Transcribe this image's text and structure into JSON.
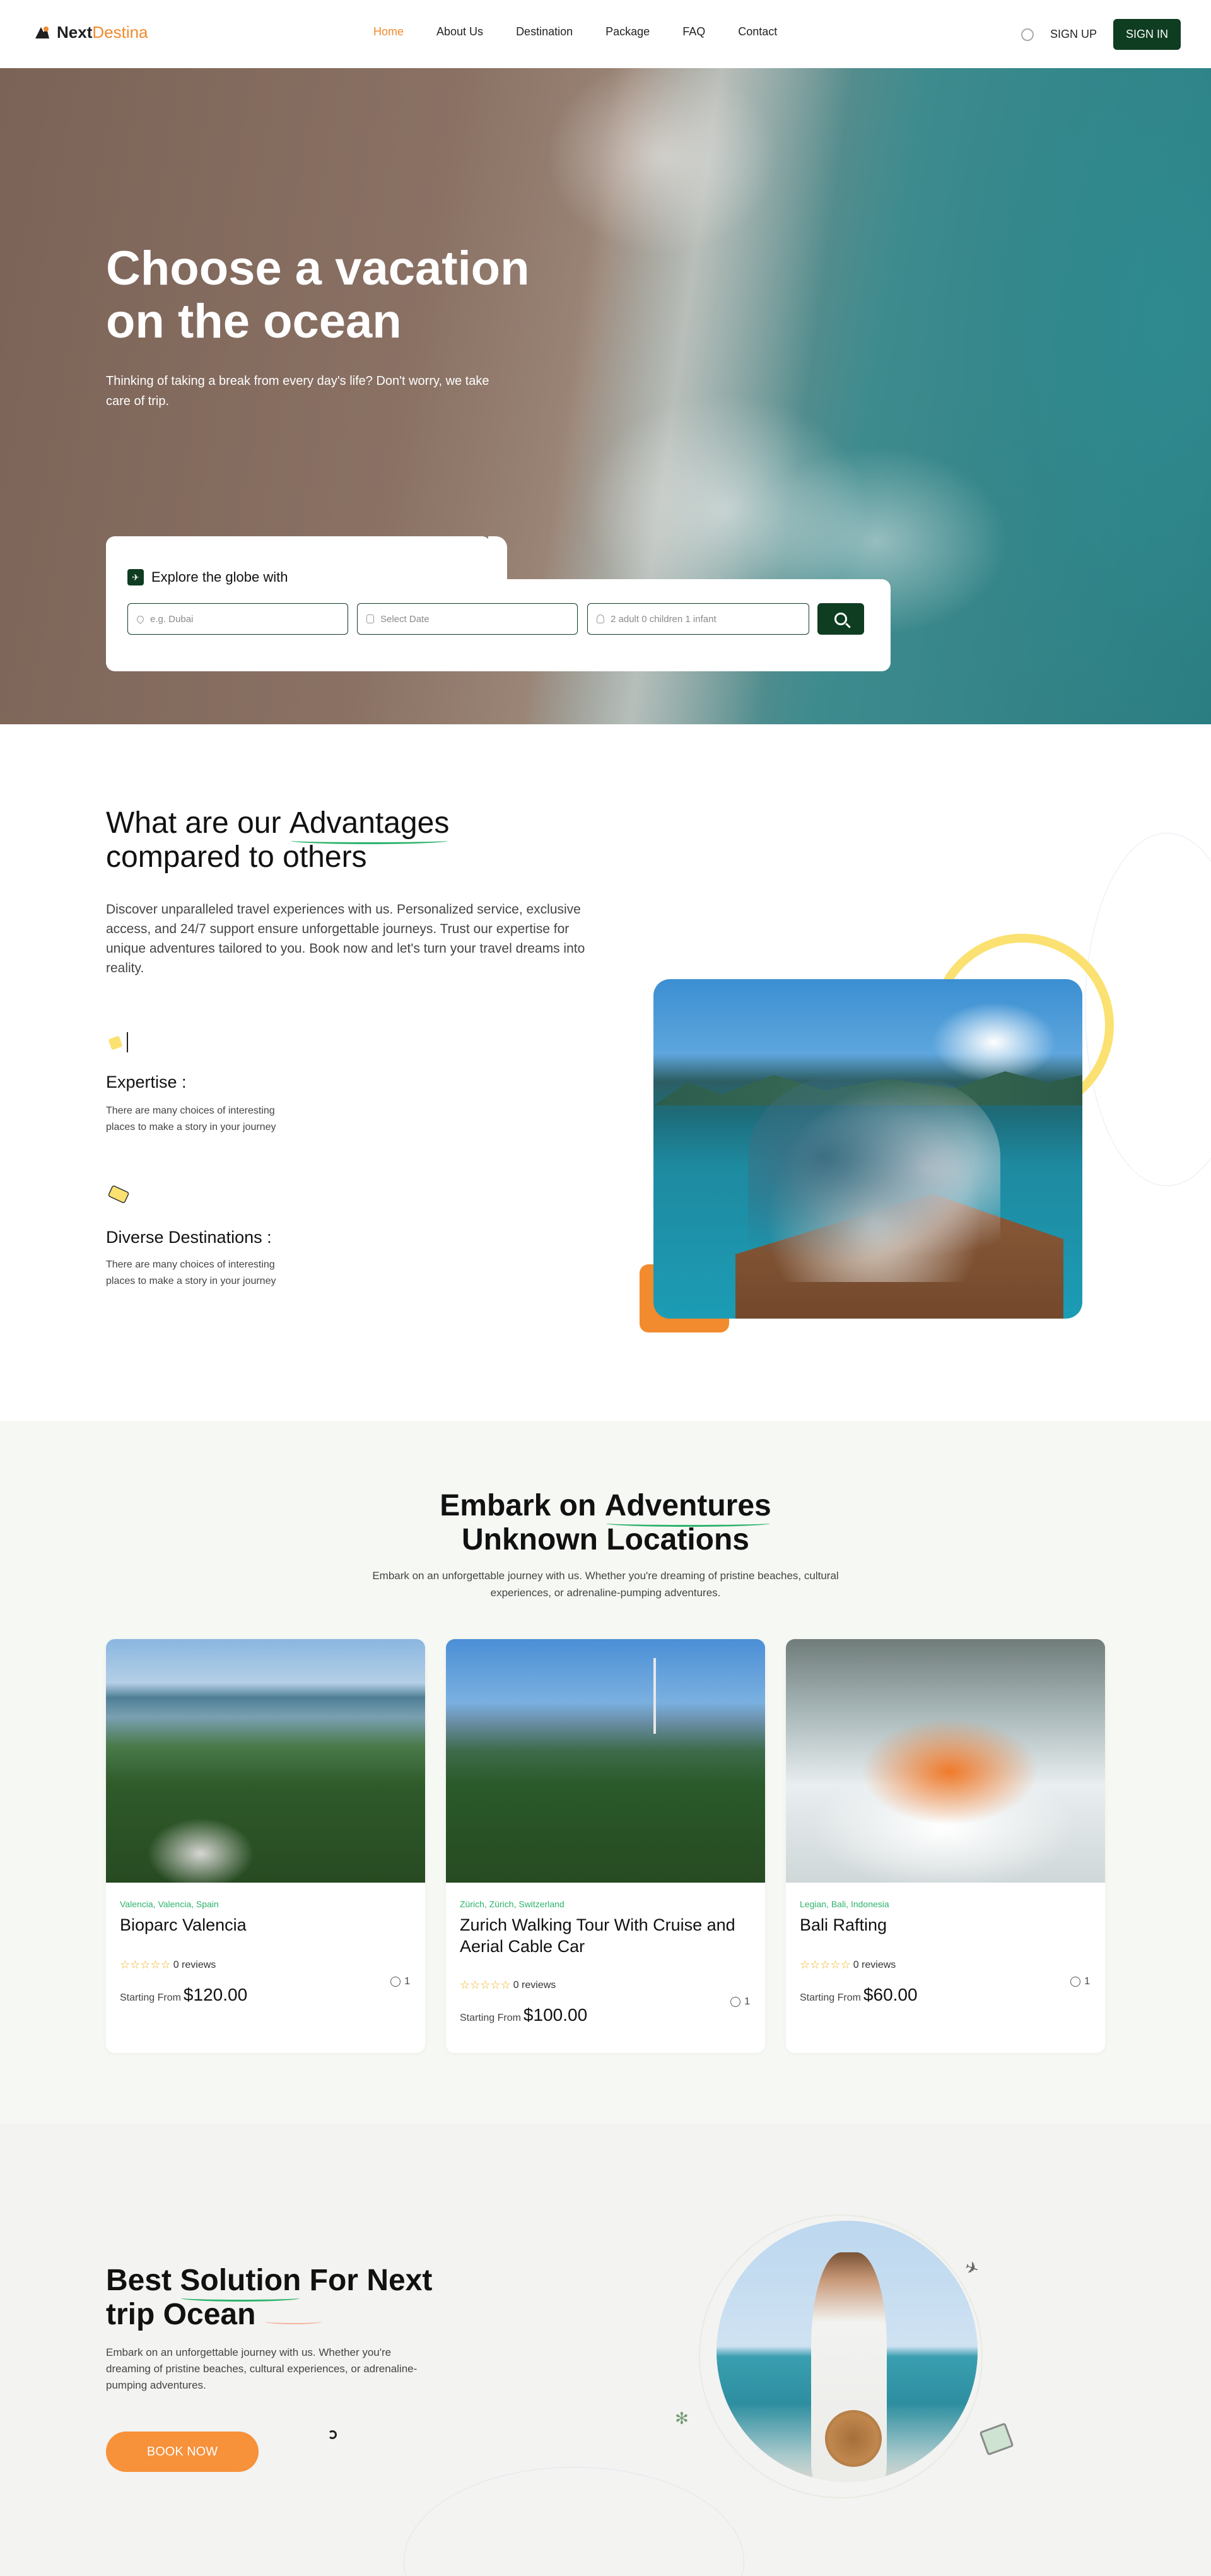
{
  "nav": {
    "logo": {
      "part1": "Next",
      "part2": "Destina"
    },
    "items": [
      "Home",
      "About Us",
      "Destination",
      "Package",
      "FAQ",
      "Contact"
    ],
    "active": "Home",
    "signup": "SIGN UP",
    "signin": "SIGN IN"
  },
  "hero": {
    "title": "Choose a vacation on the ocean",
    "subtitle": "Thinking of taking a break from every day's life? Don't worry, we take care of trip.",
    "search": {
      "label": "Explore the globe with",
      "destination_placeholder": "e.g. Dubai",
      "date_placeholder": "Select Date",
      "guests_placeholder": "2 adult  0 children  1 infant"
    }
  },
  "advantages": {
    "title_pre": "What are our ",
    "title_highlight": "Advantages",
    "title_post": " compared to others",
    "description": "Discover unparalleled travel experiences with us. Personalized service, exclusive access, and 24/7 support ensure unforgettable journeys. Trust our expertise for unique adventures tailored to you. Book now and let's turn your travel dreams into reality.",
    "features": [
      {
        "title": "Expertise :",
        "desc": "There are many choices of interesting places to make a story in your journey"
      },
      {
        "title": "Diverse Destinations :",
        "desc": "There are many choices of interesting places to make a story in your journey"
      }
    ]
  },
  "embark": {
    "title_pre": "Embark on ",
    "title_highlight": "Adventures",
    "title_post": " Unknown Locations",
    "subtitle": "Embark on an unforgettable journey with us. Whether you're dreaming of pristine beaches, cultural experiences, or adrenaline-pumping adventures.",
    "cards": [
      {
        "location": "Valencia, Valencia, Spain",
        "name": "Bioparc Valencia",
        "reviews": "0 reviews",
        "price_label": "Starting From",
        "price": "$120.00",
        "duration": "1"
      },
      {
        "location": "Zürich, Zürich, Switzerland",
        "name": "Zurich Walking Tour With Cruise and Aerial Cable Car",
        "reviews": "0 reviews",
        "price_label": "Starting From",
        "price": "$100.00",
        "duration": "1"
      },
      {
        "location": "Legian, Bali, Indonesia",
        "name": "Bali Rafting",
        "reviews": "0 reviews",
        "price_label": "Starting From",
        "price": "$60.00",
        "duration": "1"
      }
    ]
  },
  "best": {
    "title_pre": "Best ",
    "title_highlight": "Solution",
    "title_post": " For Next trip Ocean",
    "description": "Embark on an unforgettable journey with us. Whether you're dreaming of pristine beaches, cultural experiences, or adrenaline-pumping adventures.",
    "button": "BOOK NOW"
  },
  "colors": {
    "brand_green": "#0f3d22",
    "accent_orange": "#f28a2e",
    "highlight_green": "#2db36b",
    "star_yellow": "#f2b01e"
  }
}
